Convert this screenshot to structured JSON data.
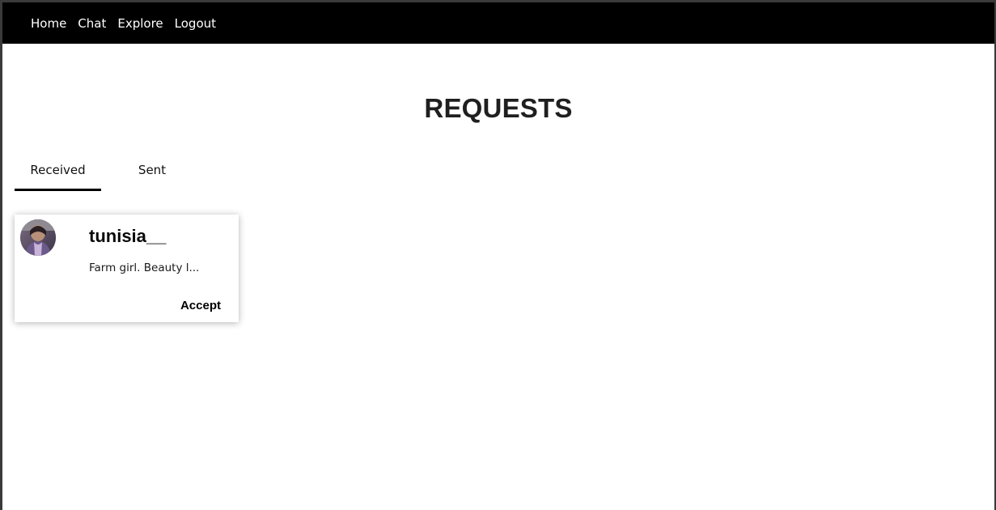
{
  "nav": {
    "links": [
      "Home",
      "Chat",
      "Explore",
      "Logout"
    ]
  },
  "page": {
    "title": "REQUESTS"
  },
  "tabs": {
    "received": "Received",
    "sent": "Sent",
    "active": "Received"
  },
  "requests": [
    {
      "username": "tunisia__",
      "bio": "Farm girl. Beauty l...",
      "action": "Accept"
    }
  ],
  "colors": {
    "navbar_bg": "#000000",
    "page_bg": "#ffffff",
    "title": "#1f1f1f",
    "active_tab_underline": "#000000"
  },
  "icons": {
    "avatar": "profile-photo-avatar"
  }
}
